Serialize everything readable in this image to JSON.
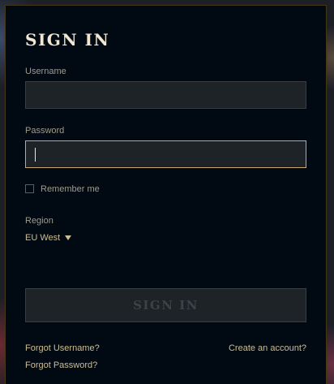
{
  "signin": {
    "title": "SIGN IN",
    "username": {
      "label": "Username",
      "value": ""
    },
    "password": {
      "label": "Password",
      "value": ""
    },
    "remember_me": {
      "label": "Remember me",
      "checked": false
    },
    "region": {
      "label": "Region",
      "selected": "EU West"
    },
    "submit_label": "SIGN IN",
    "links": {
      "forgot_username": "Forgot Username?",
      "forgot_password": "Forgot Password?",
      "create_account": "Create an account?"
    }
  },
  "colors": {
    "panel_bg": "#010a13",
    "gold": "#c8aa6e",
    "text_light": "#f0e6d2",
    "text_muted": "#a09b8c",
    "link": "#cdbe91",
    "disabled_text": "#3e4146"
  }
}
